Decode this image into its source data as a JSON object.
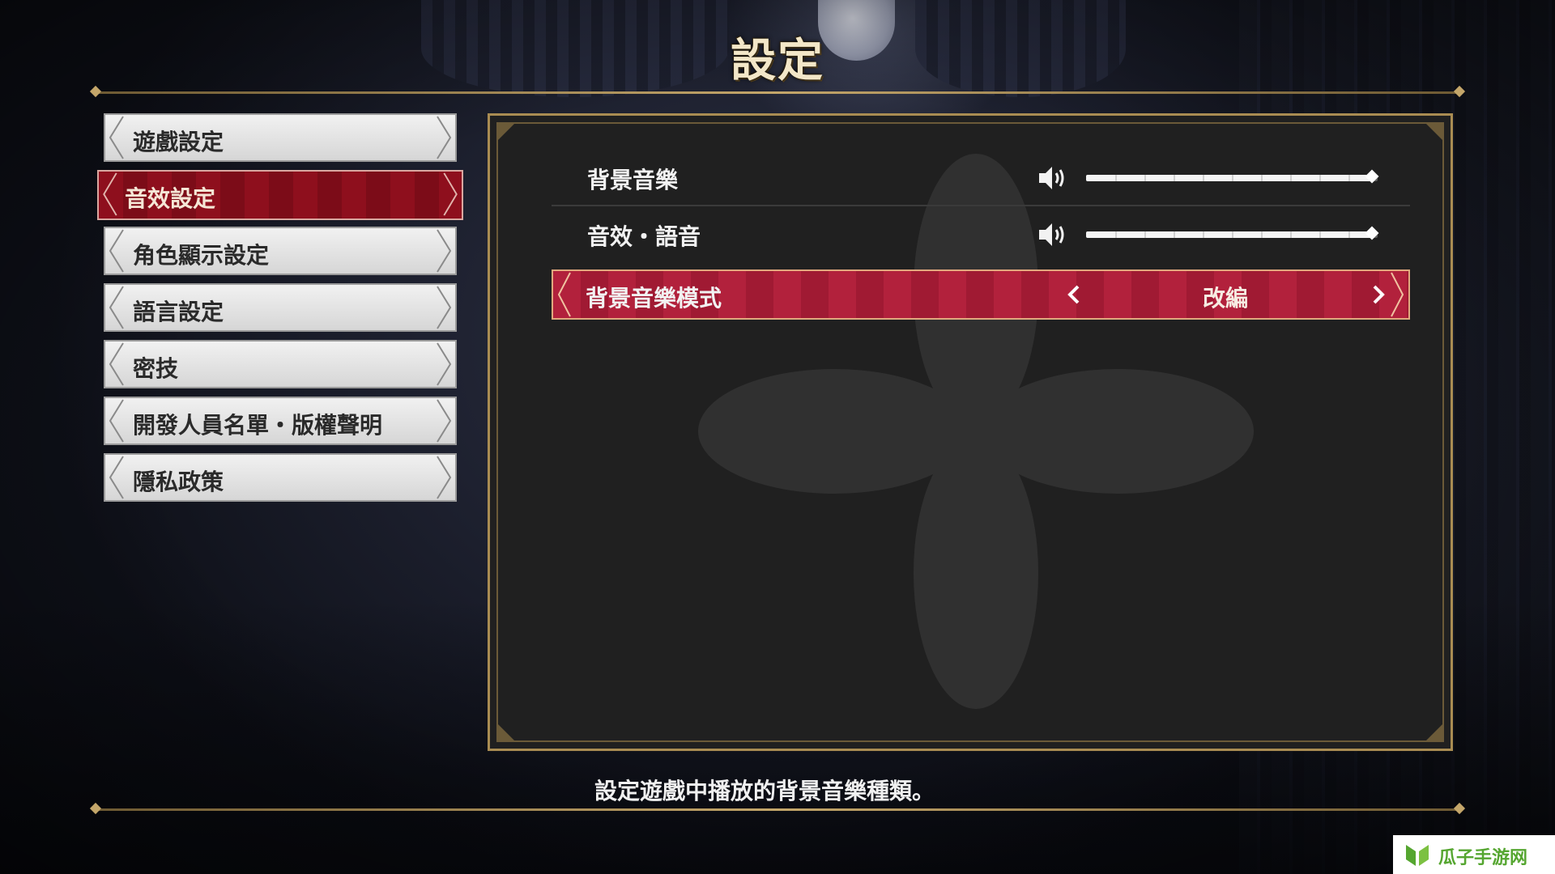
{
  "title": "設定",
  "menu": {
    "items": [
      {
        "label": "遊戲設定",
        "active": false
      },
      {
        "label": "音效設定",
        "active": true
      },
      {
        "label": "角色顯示設定",
        "active": false
      },
      {
        "label": "語言設定",
        "active": false
      },
      {
        "label": "密技",
        "active": false
      },
      {
        "label": "開發人員名單・版權聲明",
        "active": false
      },
      {
        "label": "隱私政策",
        "active": false
      }
    ]
  },
  "settings": {
    "bgm_volume": {
      "label": "背景音樂",
      "level": 0.98,
      "icon": "speaker-icon"
    },
    "se_voice_volume": {
      "label": "音效・語音",
      "level": 0.98,
      "icon": "speaker-icon"
    },
    "bgm_mode": {
      "label": "背景音樂模式",
      "value": "改編"
    }
  },
  "description": "設定遊戲中播放的背景音樂種類。",
  "watermark": {
    "text": "瓜子手游网"
  },
  "colors": {
    "gold": "#a98c52",
    "active_red": "#b2213c",
    "menu_active": "#8e0f1d"
  }
}
